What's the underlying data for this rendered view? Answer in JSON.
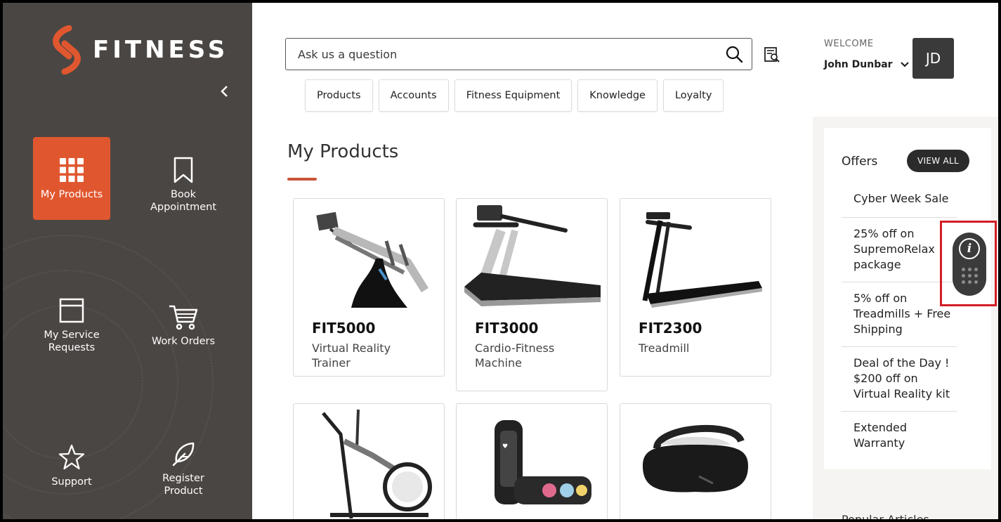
{
  "brand": {
    "name": "FITNESS",
    "logo_color": "#e0572f"
  },
  "sidebar": {
    "collapse_icon": "chevron-left-icon",
    "items": [
      {
        "label": "My Products",
        "icon": "grid-icon",
        "active": true
      },
      {
        "label": "Book Appointment",
        "icon": "bookmark-icon",
        "active": false
      },
      {
        "label": "My Service Requests",
        "icon": "window-icon",
        "active": false
      },
      {
        "label": "Work Orders",
        "icon": "cart-icon",
        "active": false
      },
      {
        "label": "Support",
        "icon": "star-icon",
        "active": false
      },
      {
        "label": "Register Product",
        "icon": "feather-icon",
        "active": false
      }
    ]
  },
  "search": {
    "placeholder": "Ask us a question"
  },
  "user": {
    "welcome": "WELCOME",
    "name": "John Dunbar",
    "initials": "JD"
  },
  "chips": [
    "Products",
    "Accounts",
    "Fitness Equipment",
    "Knowledge",
    "Loyalty"
  ],
  "main": {
    "title": "My Products"
  },
  "products": [
    {
      "code": "FIT5000",
      "desc": "Virtual Reality Trainer"
    },
    {
      "code": "FIT3000",
      "desc": "Cardio-Fitness Machine"
    },
    {
      "code": "FIT2300",
      "desc": "Treadmill"
    },
    {
      "code": "",
      "desc": ""
    },
    {
      "code": "",
      "desc": ""
    },
    {
      "code": "",
      "desc": ""
    }
  ],
  "offers": {
    "title": "Offers",
    "view_all": "VIEW ALL",
    "items": [
      "Cyber Week Sale",
      "25% off on SupremoRelax package",
      "5% off on Treadmills + Free Shipping",
      "Deal of the Day ! $200 off on Virtual Reality kit",
      "Extended Warranty"
    ]
  },
  "popular_articles": "Popular Articles"
}
